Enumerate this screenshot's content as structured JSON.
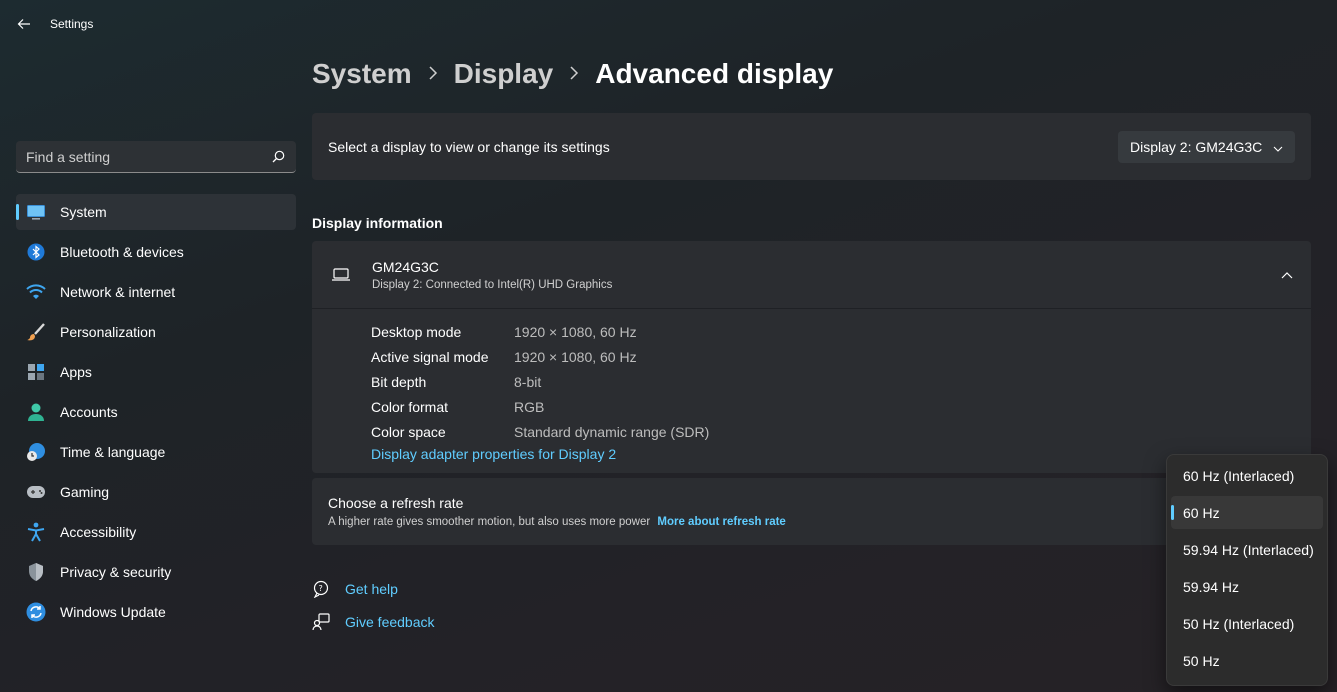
{
  "window": {
    "title": "Settings"
  },
  "search": {
    "placeholder": "Find a setting",
    "value": ""
  },
  "sidebar": {
    "items": [
      {
        "label": "System",
        "icon": "monitor-icon",
        "active": true
      },
      {
        "label": "Bluetooth & devices",
        "icon": "bluetooth-icon"
      },
      {
        "label": "Network & internet",
        "icon": "wifi-icon"
      },
      {
        "label": "Personalization",
        "icon": "brush-icon"
      },
      {
        "label": "Apps",
        "icon": "apps-icon"
      },
      {
        "label": "Accounts",
        "icon": "person-icon"
      },
      {
        "label": "Time & language",
        "icon": "globe-clock-icon"
      },
      {
        "label": "Gaming",
        "icon": "gamepad-icon"
      },
      {
        "label": "Accessibility",
        "icon": "accessibility-icon"
      },
      {
        "label": "Privacy & security",
        "icon": "shield-icon"
      },
      {
        "label": "Windows Update",
        "icon": "update-icon"
      }
    ]
  },
  "breadcrumb": {
    "items": [
      "System",
      "Display",
      "Advanced display"
    ]
  },
  "select_display": {
    "label": "Select a display to view or change its settings",
    "value": "Display 2: GM24G3C"
  },
  "display_info": {
    "section_title": "Display information",
    "name": "GM24G3C",
    "subtitle": "Display 2: Connected to Intel(R) UHD Graphics",
    "rows": [
      {
        "key": "Desktop mode",
        "value": "1920 × 1080, 60 Hz"
      },
      {
        "key": "Active signal mode",
        "value": "1920 × 1080, 60 Hz"
      },
      {
        "key": "Bit depth",
        "value": "8-bit"
      },
      {
        "key": "Color format",
        "value": "RGB"
      },
      {
        "key": "Color space",
        "value": "Standard dynamic range (SDR)"
      }
    ],
    "adapter_link": "Display adapter properties for Display 2"
  },
  "refresh_rate": {
    "title": "Choose a refresh rate",
    "subtitle": "A higher rate gives smoother motion, but also uses more power",
    "link": "More about refresh rate",
    "options": [
      "60 Hz (Interlaced)",
      "60 Hz",
      "59.94 Hz (Interlaced)",
      "59.94 Hz",
      "50 Hz (Interlaced)",
      "50 Hz"
    ],
    "selected": "60 Hz"
  },
  "help": {
    "get_help": "Get help",
    "give_feedback": "Give feedback"
  },
  "colors": {
    "accent": "#60cdff",
    "background": "#1f2327",
    "card": "#2b2d31"
  }
}
